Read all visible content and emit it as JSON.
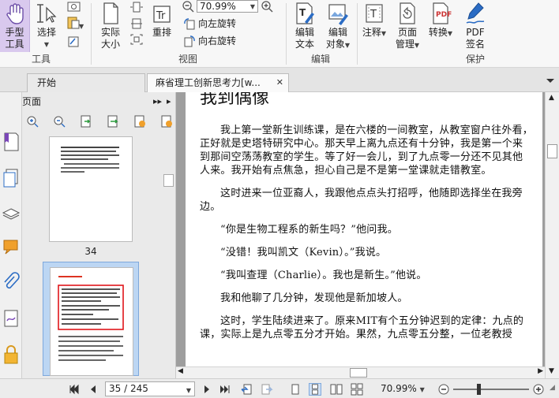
{
  "ribbon": {
    "tools": {
      "hand_label_line1": "手型",
      "hand_label_line2": "工具",
      "select_label": "选择",
      "group_label": "工具"
    },
    "view": {
      "actual_size_line1": "实际",
      "actual_size_line2": "大小",
      "reflow_label": "重排",
      "zoom_value": "70.99%",
      "rotate_left": "向左旋转",
      "rotate_right": "向右旋转",
      "group_label": "视图"
    },
    "edit": {
      "edit_text_line1": "编辑",
      "edit_text_line2": "文本",
      "edit_object_line1": "编辑",
      "edit_object_line2": "对象",
      "group_label": "编辑"
    },
    "annotate_label": "注释",
    "page_manage_line1": "页面",
    "page_manage_line2": "管理",
    "convert_label": "转换",
    "protect": {
      "sign_line1": "PDF",
      "sign_line2": "签名",
      "group_label": "保护"
    }
  },
  "tabs": {
    "start": "开始",
    "document": "麻省理工创新思考力[w...",
    "close_glyph": "✕"
  },
  "thumbnails": {
    "panel_title": "页面",
    "page_34_label": "34"
  },
  "document": {
    "title": "我到偶像",
    "paragraphs": [
      "我上第一堂新生训练课，是在六楼的一间教室，从教室窗户往外看，正好就是史塔特研究中心。那天早上离九点还有十分钟，我是第一个来到那间空荡荡教室的学生。等了好一会儿，到了九点零一分还不见其他人来。我开始有点焦急，担心自己是不是第一堂课就走错教室。",
      "这时进来一位亚裔人，我跟他点点头打招呼，他随即选择坐在我旁边。",
      "“你是生物工程系的新生吗？”他问我。",
      "“没错！我叫凯文（Kevin）。”我说。",
      "“我叫查理（Charlie）。我也是新生。”他说。",
      "我和他聊了几分钟，发现他是新加坡人。",
      "这时，学生陆续进来了。原来MIT有个五分钟迟到的定律：九点的课，实际上是九点零五分才开始。果然，九点零五分整，一位老教授"
    ]
  },
  "statusbar": {
    "page_indicator": "35 / 245",
    "zoom": "70.99%"
  },
  "colors": {
    "accent_blue": "#2b6cc4",
    "thumb_selected_bg": "#bcd6f3",
    "highlight_red": "#e0161b"
  }
}
